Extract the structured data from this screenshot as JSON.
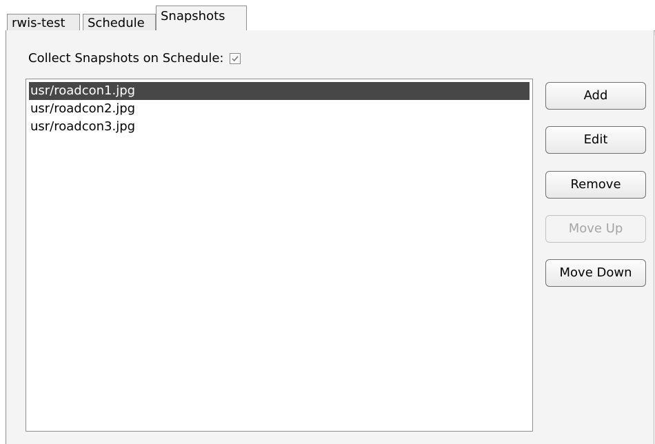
{
  "tabs": [
    {
      "label": "rwis-test",
      "active": false
    },
    {
      "label": "Schedule",
      "active": false
    },
    {
      "label": "Snapshots",
      "active": true
    }
  ],
  "collect": {
    "label": "Collect Snapshots on Schedule:",
    "checked": true
  },
  "snapshots": [
    {
      "path": "usr/roadcon1.jpg",
      "selected": true
    },
    {
      "path": "usr/roadcon2.jpg",
      "selected": false
    },
    {
      "path": "usr/roadcon3.jpg",
      "selected": false
    }
  ],
  "buttons": {
    "add": "Add",
    "edit": "Edit",
    "remove": "Remove",
    "move_up": "Move Up",
    "move_down": "Move Down"
  },
  "colors": {
    "selection": "#474747",
    "panel": "#f4f4f4",
    "disabled_text": "#a5a5a5"
  }
}
